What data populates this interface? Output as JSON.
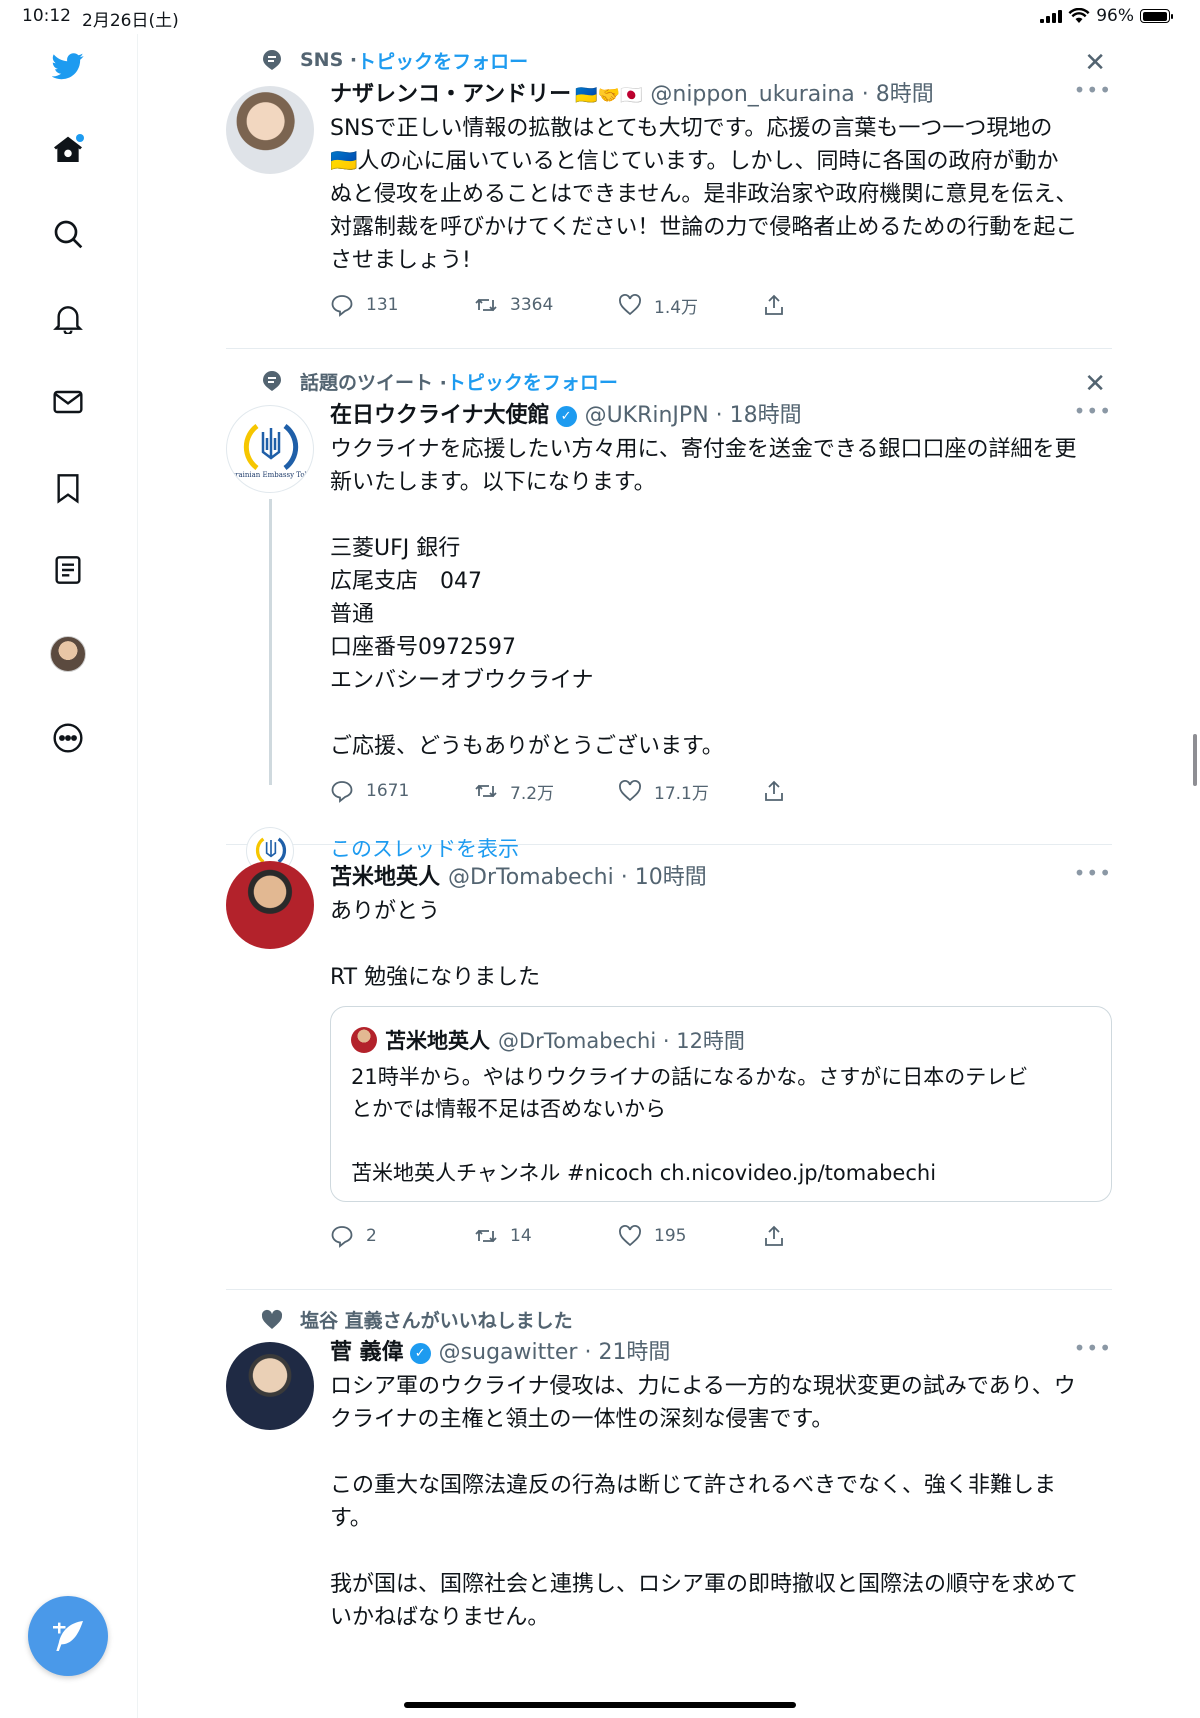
{
  "status_bar": {
    "time": "10:12",
    "date": "2月26日(土)",
    "battery": "96%",
    "battery_level": 0.96
  },
  "colors": {
    "accent": "#1d9bf0",
    "text": "#0f1419",
    "secondary": "#536471",
    "compose": "#4a99e9"
  },
  "sidebar": {
    "items": [
      {
        "icon": "twitter-bird-icon"
      },
      {
        "icon": "home-icon"
      },
      {
        "icon": "search-icon"
      },
      {
        "icon": "bell-icon"
      },
      {
        "icon": "mail-icon"
      },
      {
        "icon": "bookmark-icon"
      },
      {
        "icon": "lists-icon"
      },
      {
        "icon": "profile-avatar"
      },
      {
        "icon": "more-circle-icon"
      }
    ],
    "compose_icon": "compose-feather-icon"
  },
  "tweets": [
    {
      "context": "SNS · ",
      "context_link": "トピックをフォロー",
      "name": "ナザレンコ・アンドリー",
      "flags": "🇺🇦🤝🇯🇵",
      "handle": "@nippon_ukuraina · 8時間",
      "text": "SNSで正しい情報の拡散はとても大切です。応援の言葉も一つ一つ現地の\n🇺🇦人の心に届いていると信じています。しかし、同時に各国の政府が動か\nぬと侵攻を止めることはできません。是非政治家や政府機関に意見を伝え、\n対露制裁を呼びかけてください！世論の力で侵略者止めるための行動を起こ\nさせましょう!",
      "replies": "131",
      "retweets": "3364",
      "likes": "1.4万"
    },
    {
      "context": "話題のツイート · ",
      "context_link": "トピックをフォロー",
      "name": "在日ウクライナ大使館",
      "verified": "✓",
      "handle": "@UKRinJPN · 18時間",
      "text": "ウクライナを応援したい方々用に、寄付金を送金できる銀口口座の詳細を更\n新いたします。以下になります。\n\n三菱UFJ 銀行\n広尾支店　047\n普通\n口座番号0972597\nエンバシーオブウクライナ\n\nご応援、どうもありがとうございます。",
      "replies": "1671",
      "retweets": "7.2万",
      "likes": "17.1万",
      "avatar_text": "Ukrainian Embassy Tokyo",
      "show_thread": "このスレッドを表示"
    },
    {
      "name": "苫米地英人",
      "handle": "@DrTomabechi · 10時間",
      "text": "ありがとう\n\nRT 勉強になりました",
      "quote": {
        "name": "苫米地英人",
        "handle": "@DrTomabechi · 12時間",
        "text": "21時半から。やはりウクライナの話になるかな。さすがに日本のテレビ\nとかでは情報不足は否めないから\n\n苫米地英人チャンネル #nicoch ch.nicovideo.jp/tomabechi"
      },
      "replies": "2",
      "retweets": "14",
      "likes": "195"
    },
    {
      "context": "塩谷 直義さんがいいねしました",
      "name": "菅 義偉",
      "verified": "✓",
      "handle": "@sugawitter · 21時間",
      "text": "ロシア軍のウクライナ侵攻は、力による一方的な現状変更の試みであり、ウ\nクライナの主権と領土の一体性の深刻な侵害です。\n\nこの重大な国際法違反の行為は断じて許されるべきでなく、強く非難しま\nす。\n\n我が国は、国際社会と連携し、ロシア軍の即時撤収と国際法の順守を求めて\nいかねばなりません。"
    }
  ],
  "more_label": "•••",
  "close_label": "✕"
}
